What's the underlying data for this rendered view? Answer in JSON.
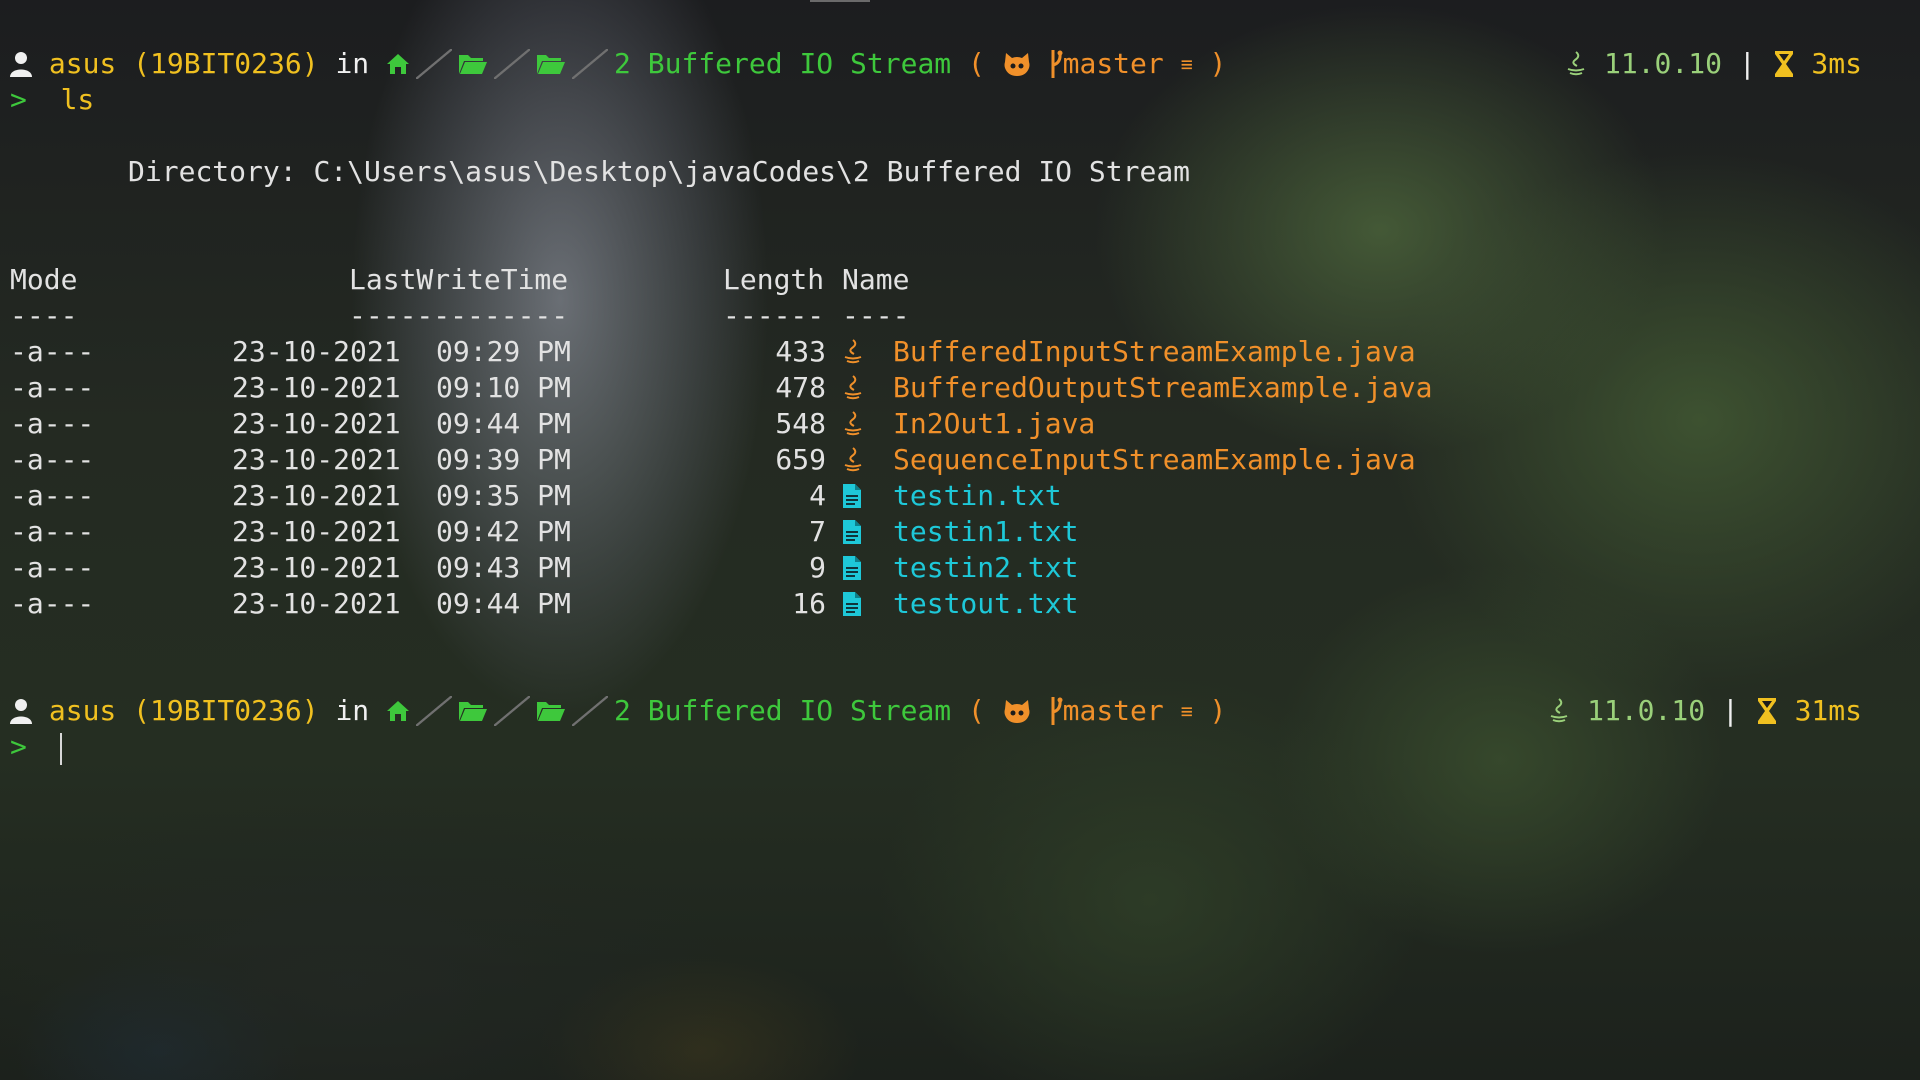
{
  "prompts": [
    {
      "user": "asus (19BIT0236)",
      "in": "in",
      "folder": "2 Buffered IO Stream",
      "paren_open": "(",
      "branch": "master",
      "branch_state": "≡",
      "paren_close": ")",
      "java_version": "11.0.10",
      "divider": "|",
      "duration": "3ms",
      "marker": ">",
      "command": "ls"
    },
    {
      "user": "asus (19BIT0236)",
      "in": "in",
      "folder": "2 Buffered IO Stream",
      "paren_open": "(",
      "branch": "master",
      "branch_state": "≡",
      "paren_close": ")",
      "java_version": "11.0.10",
      "divider": "|",
      "duration": "31ms",
      "marker": ">",
      "command": ""
    }
  ],
  "listing": {
    "directory_label": "Directory:",
    "directory_path": "C:\\Users\\asus\\Desktop\\javaCodes\\2 Buffered IO Stream",
    "headers": {
      "mode": "Mode",
      "lastwrite": "LastWriteTime",
      "length": "Length",
      "name": "Name"
    },
    "underlines": {
      "mode": "----",
      "lastwrite": "-------------",
      "length": "------",
      "name": "----"
    },
    "rows": [
      {
        "mode": "-a---",
        "date": "23-10-2021",
        "time": "09:29 PM",
        "length": "433",
        "name": "BufferedInputStreamExample.java",
        "type": "java"
      },
      {
        "mode": "-a---",
        "date": "23-10-2021",
        "time": "09:10 PM",
        "length": "478",
        "name": "BufferedOutputStreamExample.java",
        "type": "java"
      },
      {
        "mode": "-a---",
        "date": "23-10-2021",
        "time": "09:44 PM",
        "length": "548",
        "name": "In2Out1.java",
        "type": "java"
      },
      {
        "mode": "-a---",
        "date": "23-10-2021",
        "time": "09:39 PM",
        "length": "659",
        "name": "SequenceInputStreamExample.java",
        "type": "java"
      },
      {
        "mode": "-a---",
        "date": "23-10-2021",
        "time": "09:35 PM",
        "length": "4",
        "name": "testin.txt",
        "type": "txt"
      },
      {
        "mode": "-a---",
        "date": "23-10-2021",
        "time": "09:42 PM",
        "length": "7",
        "name": "testin1.txt",
        "type": "txt"
      },
      {
        "mode": "-a---",
        "date": "23-10-2021",
        "time": "09:43 PM",
        "length": "9",
        "name": "testin2.txt",
        "type": "txt"
      },
      {
        "mode": "-a---",
        "date": "23-10-2021",
        "time": "09:44 PM",
        "length": "16",
        "name": "testout.txt",
        "type": "txt"
      }
    ]
  },
  "colors": {
    "user": "#f0c020",
    "path": "#3ec83c",
    "git": "#f0902a",
    "java_file": "#f0902a",
    "txt_file": "#1ec8d8",
    "java_version": "#9ad07a"
  },
  "icons": {
    "user": "user-icon",
    "home": "home-icon",
    "folder": "folder-open-icon",
    "git": "github-cat-icon",
    "branch": "git-branch-icon",
    "java": "java-icon",
    "duration": "hourglass-icon",
    "file": "file-icon"
  }
}
